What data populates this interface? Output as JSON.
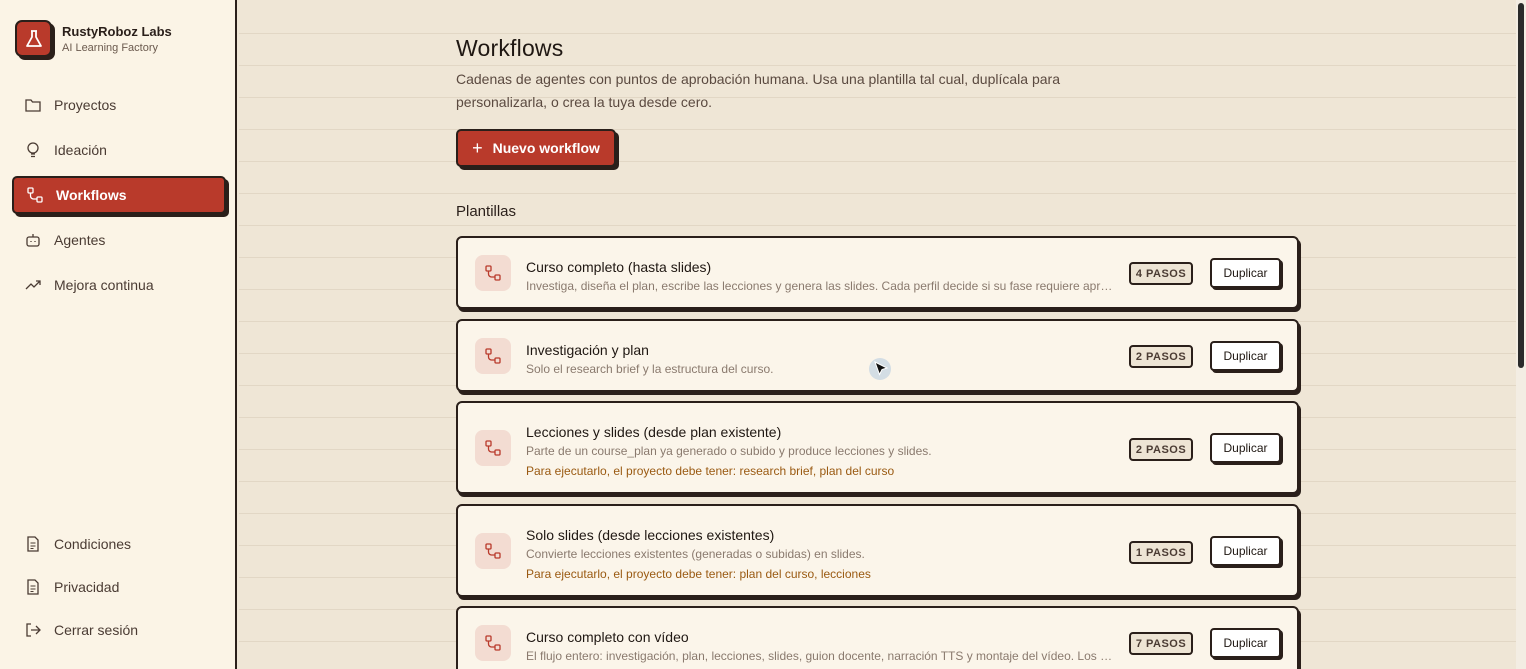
{
  "brand": {
    "name": "RustyRoboz Labs",
    "subtitle": "AI Learning Factory"
  },
  "sidebar": {
    "items": [
      {
        "label": "Proyectos",
        "icon": "folder-icon",
        "active": false
      },
      {
        "label": "Ideación",
        "icon": "lightbulb-icon",
        "active": false
      },
      {
        "label": "Workflows",
        "icon": "workflow-icon",
        "active": true
      },
      {
        "label": "Agentes",
        "icon": "robot-icon",
        "active": false
      },
      {
        "label": "Mejora continua",
        "icon": "trend-up-icon",
        "active": false
      }
    ],
    "bottom_items": [
      {
        "label": "Condiciones",
        "icon": "document-icon"
      },
      {
        "label": "Privacidad",
        "icon": "document-icon"
      },
      {
        "label": "Cerrar sesión",
        "icon": "logout-icon"
      }
    ]
  },
  "main": {
    "title": "Workflows",
    "description": "Cadenas de agentes con puntos de aprobación humana. Usa una plantilla tal cual, duplícala para personalizarla, o crea la tuya desde cero.",
    "new_button": "Nuevo workflow",
    "section_title": "Plantillas",
    "templates": [
      {
        "title": "Curso completo (hasta slides)",
        "description": "Investiga, diseña el plan, escribe las lecciones y genera las slides. Cada perfil decide si su fase requiere aproba…",
        "requirement": "",
        "steps": "4 PASOS",
        "button": "Duplicar"
      },
      {
        "title": "Investigación y plan",
        "description": "Solo el research brief y la estructura del curso.",
        "requirement": "",
        "steps": "2 PASOS",
        "button": "Duplicar"
      },
      {
        "title": "Lecciones y slides (desde plan existente)",
        "description": "Parte de un course_plan ya generado o subido y produce lecciones y slides.",
        "requirement": "Para ejecutarlo, el proyecto debe tener: research brief, plan del curso",
        "steps": "2 PASOS",
        "button": "Duplicar"
      },
      {
        "title": "Solo slides (desde lecciones existentes)",
        "description": "Convierte lecciones existentes (generadas o subidas) en slides.",
        "requirement": "Para ejecutarlo, el proyecto debe tener: plan del curso, lecciones",
        "steps": "1 PASOS",
        "button": "Duplicar"
      },
      {
        "title": "Curso completo con vídeo",
        "description": "El flujo entero: investigación, plan, lecciones, slides, guion docente, narración TTS y montaje del vídeo. Los per…",
        "requirement": "",
        "steps": "7 PASOS",
        "button": "Duplicar"
      }
    ]
  },
  "colors": {
    "accent": "#b93a2b",
    "background": "#efe6d6",
    "sidebar": "#fbf4e6",
    "ink": "#2a1f1a"
  }
}
